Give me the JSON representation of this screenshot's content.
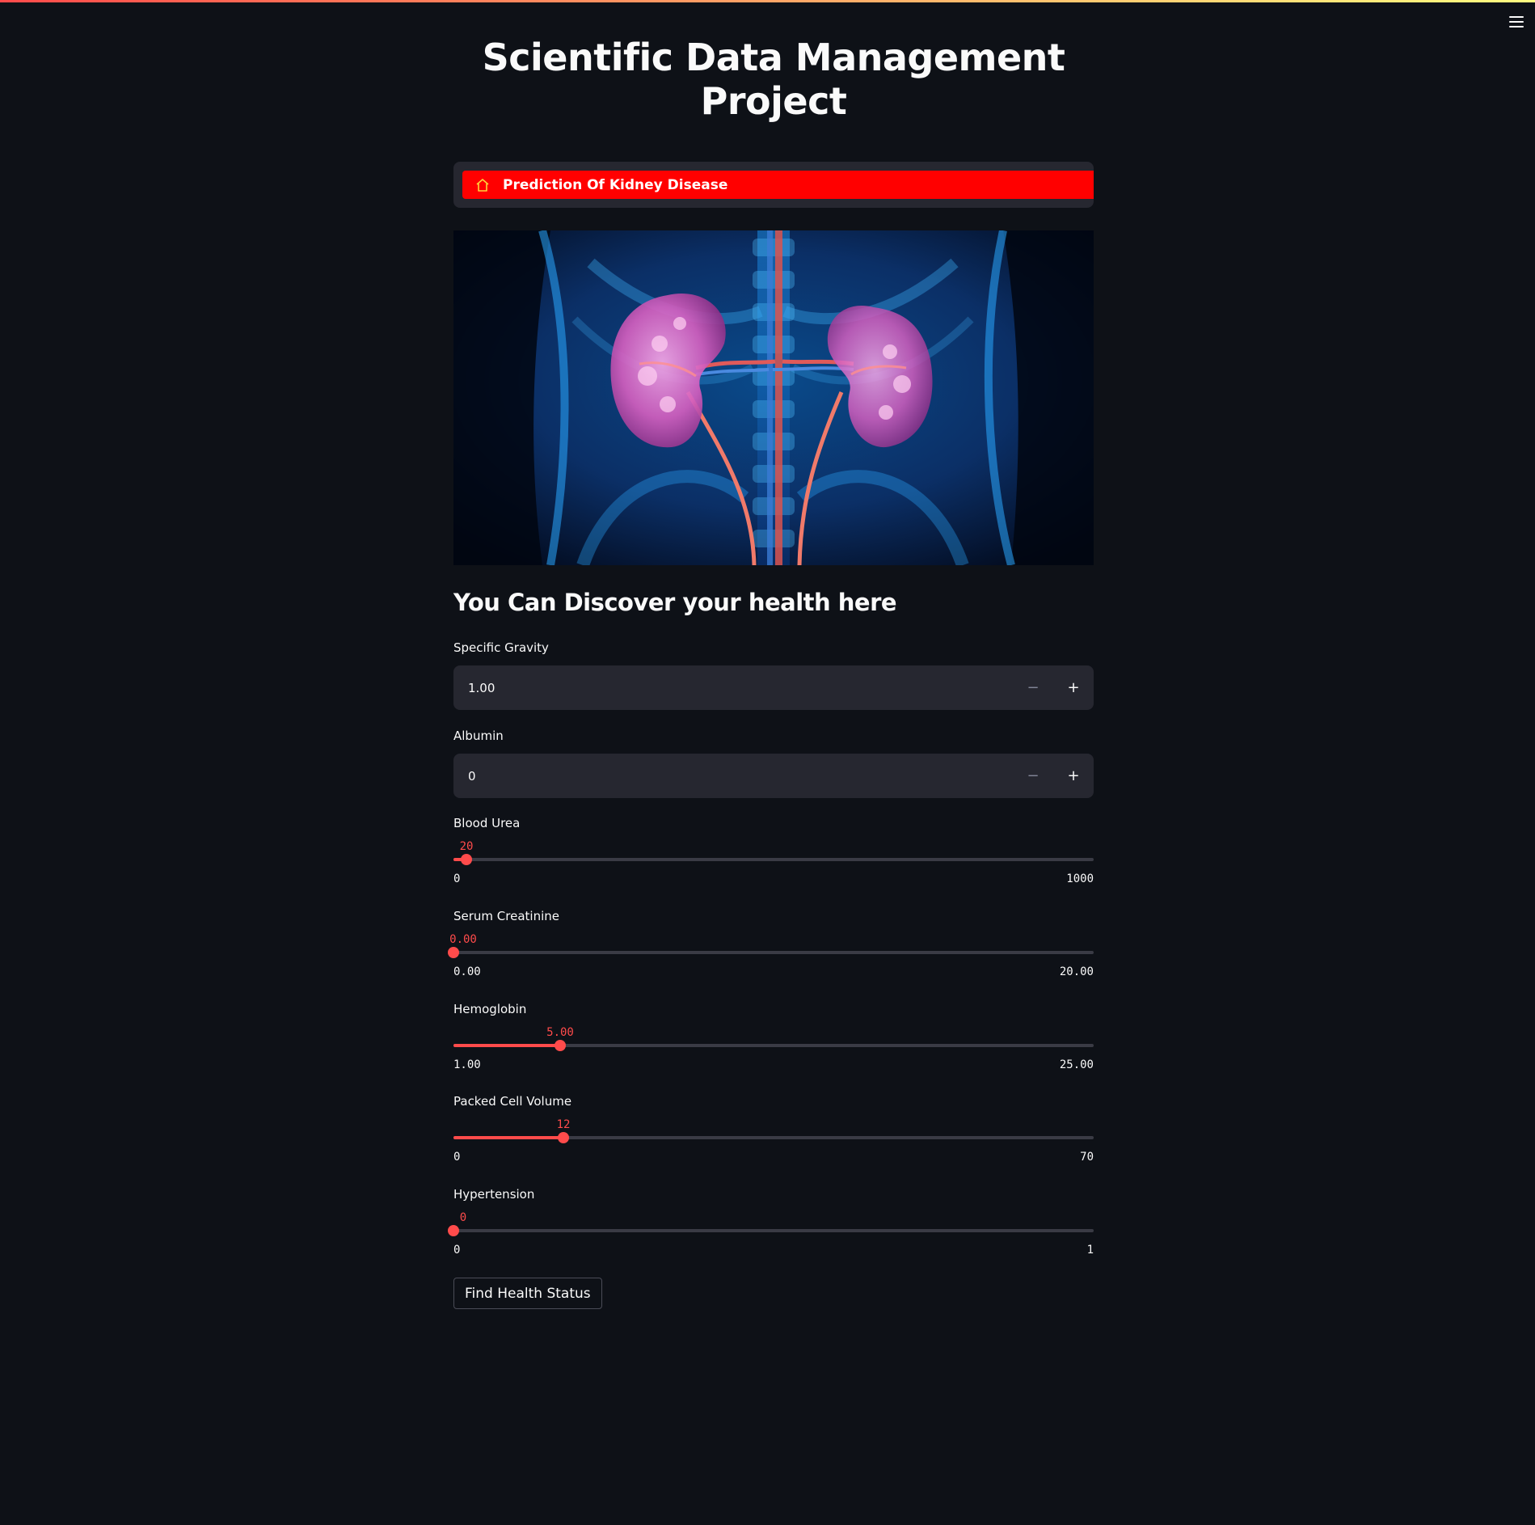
{
  "app": {
    "title": "Scientific Data Management Project",
    "accent_color": "#ff4b4b",
    "menu_icon": "hamburger-icon"
  },
  "nav": {
    "items": [
      {
        "label": "Prediction Of Kidney Disease",
        "icon": "house-icon",
        "active": true,
        "color": "#ff0000"
      }
    ]
  },
  "hero_image": {
    "subject": "kidneys-xray-illustration"
  },
  "form": {
    "heading": "You Can Discover your health here",
    "number_inputs": [
      {
        "label": "Specific Gravity",
        "value": "1.00",
        "minus": "−",
        "plus": "+"
      },
      {
        "label": "Albumin",
        "value": "0",
        "minus": "−",
        "plus": "+"
      }
    ],
    "sliders": [
      {
        "label": "Blood Urea",
        "value": "20",
        "min": "0",
        "max": "1000",
        "fraction": 0.02
      },
      {
        "label": "Serum Creatinine",
        "value": "0.00",
        "min": "0.00",
        "max": "20.00",
        "fraction": 0.0
      },
      {
        "label": "Hemoglobin",
        "value": "5.00",
        "min": "1.00",
        "max": "25.00",
        "fraction": 0.1667
      },
      {
        "label": "Packed Cell Volume",
        "value": "12",
        "min": "0",
        "max": "70",
        "fraction": 0.1714
      },
      {
        "label": "Hypertension",
        "value": "0",
        "min": "0",
        "max": "1",
        "fraction": 0.0
      }
    ],
    "submit_label": "Find Health Status"
  }
}
